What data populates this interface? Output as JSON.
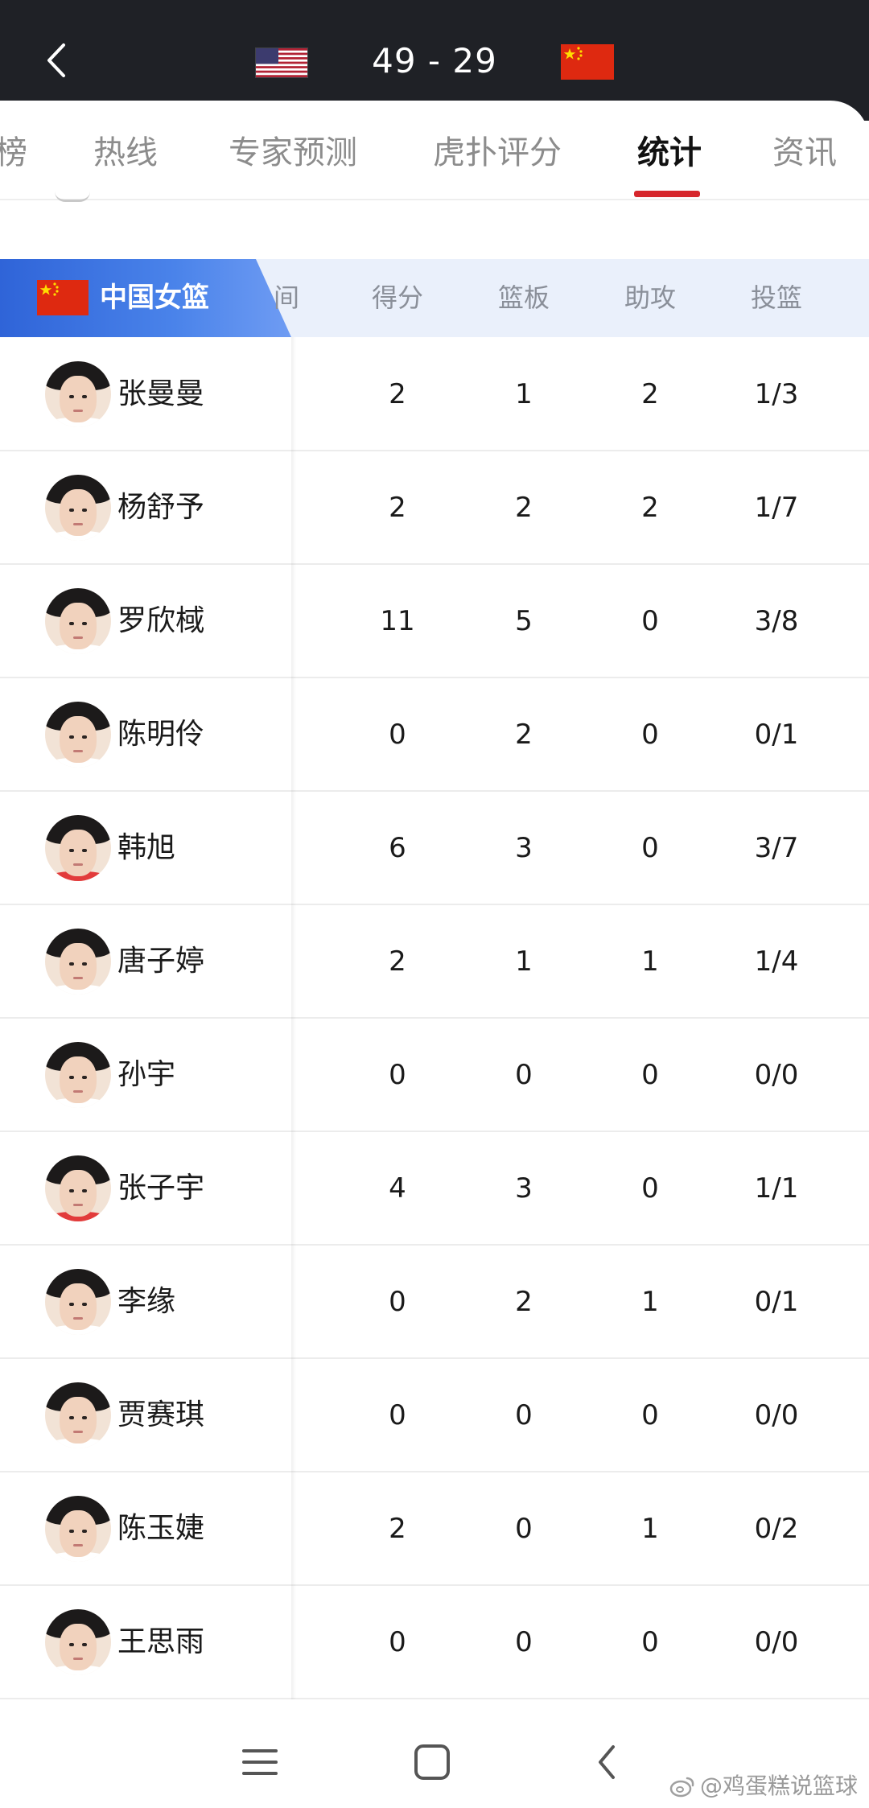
{
  "header": {
    "score": "49 - 29",
    "home_flag": "usa-flag-icon",
    "away_flag": "china-flag-icon"
  },
  "tabs": [
    {
      "label": "榜",
      "active": false
    },
    {
      "label": "热线",
      "active": false
    },
    {
      "label": "专家预测",
      "active": false
    },
    {
      "label": "虎扑评分",
      "active": false
    },
    {
      "label": "统计",
      "active": true
    },
    {
      "label": "资讯",
      "active": false
    }
  ],
  "table": {
    "team": "中国女篮",
    "columns": [
      "间",
      "得分",
      "篮板",
      "助攻",
      "投篮"
    ],
    "rows": [
      {
        "name": "张曼曼",
        "pts": "2",
        "reb": "1",
        "ast": "2",
        "fg": "1/3"
      },
      {
        "name": "杨舒予",
        "pts": "2",
        "reb": "2",
        "ast": "2",
        "fg": "1/7"
      },
      {
        "name": "罗欣棫",
        "pts": "11",
        "reb": "5",
        "ast": "0",
        "fg": "3/8"
      },
      {
        "name": "陈明伶",
        "pts": "0",
        "reb": "2",
        "ast": "0",
        "fg": "0/1"
      },
      {
        "name": "韩旭",
        "pts": "6",
        "reb": "3",
        "ast": "0",
        "fg": "3/7"
      },
      {
        "name": "唐子婷",
        "pts": "2",
        "reb": "1",
        "ast": "1",
        "fg": "1/4"
      },
      {
        "name": "孙宇",
        "pts": "0",
        "reb": "0",
        "ast": "0",
        "fg": "0/0"
      },
      {
        "name": "张子宇",
        "pts": "4",
        "reb": "3",
        "ast": "0",
        "fg": "1/1"
      },
      {
        "name": "李缘",
        "pts": "0",
        "reb": "2",
        "ast": "1",
        "fg": "0/1"
      },
      {
        "name": "贾赛琪",
        "pts": "0",
        "reb": "0",
        "ast": "0",
        "fg": "0/0"
      },
      {
        "name": "陈玉婕",
        "pts": "2",
        "reb": "0",
        "ast": "1",
        "fg": "0/2"
      },
      {
        "name": "王思雨",
        "pts": "0",
        "reb": "0",
        "ast": "0",
        "fg": "0/0"
      }
    ]
  },
  "watermark": "@鸡蛋糕说篮球",
  "colors": {
    "topbar": "#1f2126",
    "accent": "#d6262c",
    "team_badge": "#3a72e0",
    "header_bg": "#eaf0fb"
  }
}
